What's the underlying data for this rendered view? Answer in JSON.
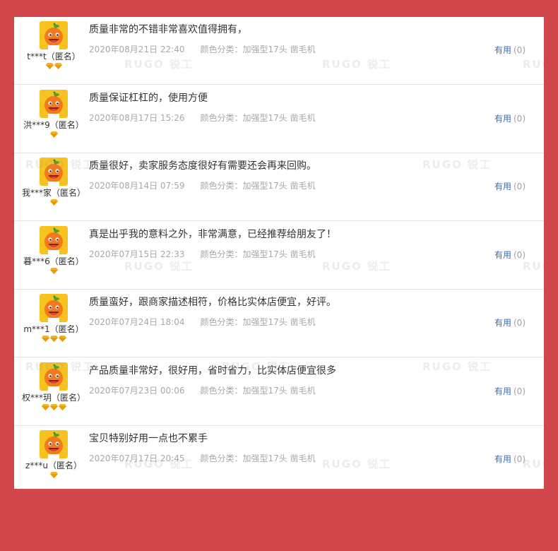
{
  "colors": {
    "background": "#d0464a",
    "panel": "#ffffff",
    "useful_link": "#3a6fb0",
    "badge": "#f5b51a",
    "avatar_bg": "#f5c21f",
    "avatar_face": "#f27a1c"
  },
  "icons": {
    "avatar": "orange-mascot-avatar-icon",
    "badge": "gold-diamond-badge-icon"
  },
  "watermark": "RUGO 锐工",
  "useful_label": "有用",
  "reviews": [
    {
      "user": "t***t（匿名）",
      "badges": 2,
      "comment": "质量非常的不错非常喜欢值得拥有，",
      "date": "2020年08月21日 22:40",
      "sku": "颜色分类：加强型17头 凿毛机",
      "useful_count": "(0)"
    },
    {
      "user": "洪***9（匿名）",
      "badges": 1,
      "comment": "质量保证杠杠的，使用方便",
      "date": "2020年08月17日 15:26",
      "sku": "颜色分类：加强型17头 凿毛机",
      "useful_count": "(0)"
    },
    {
      "user": "我***家（匿名）",
      "badges": 1,
      "comment": "质量很好，卖家服务态度很好有需要还会再来回购。",
      "date": "2020年08月14日 07:59",
      "sku": "颜色分类：加强型17头 凿毛机",
      "useful_count": "(0)"
    },
    {
      "user": "暮***6（匿名）",
      "badges": 1,
      "comment": "真是出乎我的意料之外，非常满意，已经推荐给朋友了！",
      "date": "2020年07月15日 22:33",
      "sku": "颜色分类：加强型17头 凿毛机",
      "useful_count": "(0)"
    },
    {
      "user": "m***1（匿名）",
      "badges": 3,
      "comment": "质量蛮好，跟商家描述相符，价格比实体店便宜，好评。",
      "date": "2020年07月24日 18:04",
      "sku": "颜色分类：加强型17头 凿毛机",
      "useful_count": "(0)"
    },
    {
      "user": "权***玥（匿名）",
      "badges": 3,
      "comment": "产品质量非常好，很好用，省时省力，比实体店便宜很多",
      "date": "2020年07月23日 00:06",
      "sku": "颜色分类：加强型17头 凿毛机",
      "useful_count": "(0)"
    },
    {
      "user": "z***u（匿名）",
      "badges": 1,
      "comment": "宝贝特别好用一点也不累手",
      "date": "2020年07月17日 20:45",
      "sku": "颜色分类：加强型17头 凿毛机",
      "useful_count": "(0)"
    }
  ]
}
